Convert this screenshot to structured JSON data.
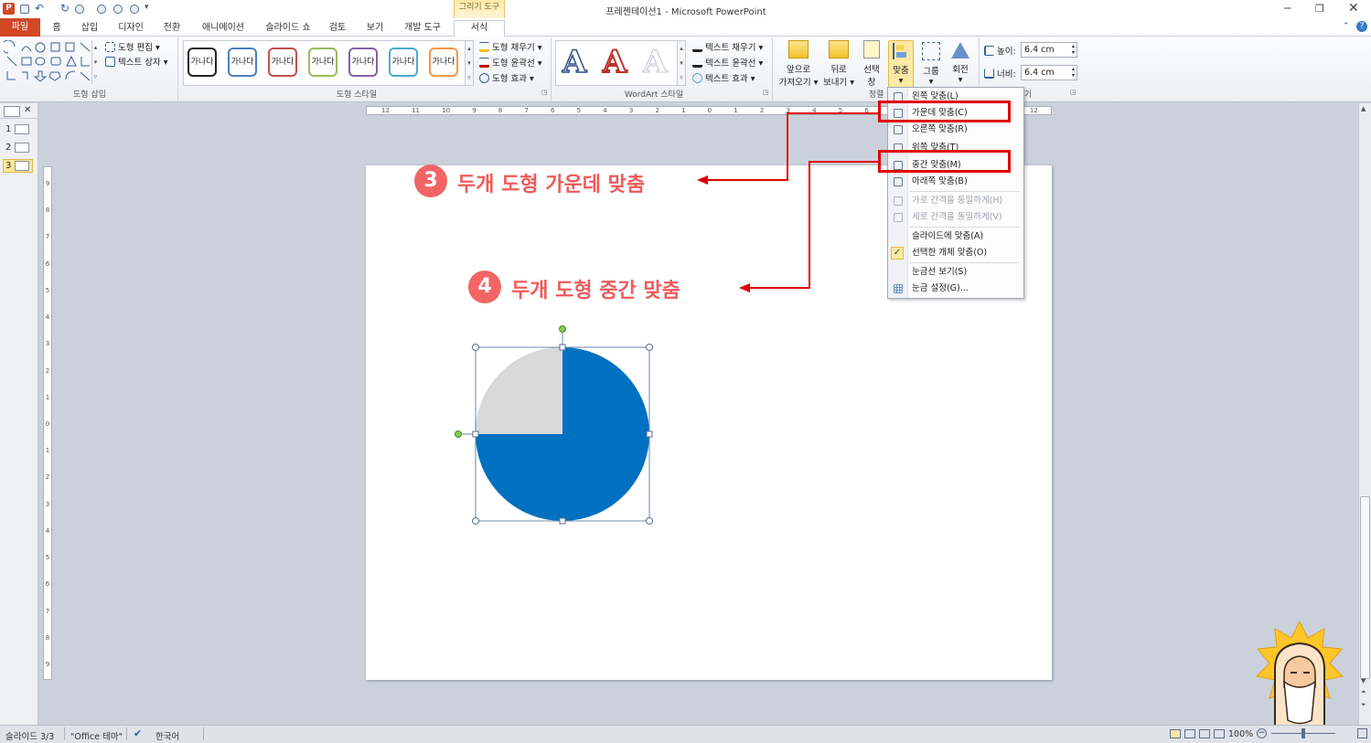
{
  "window": {
    "title": "프레젠테이션1 - Microsoft PowerPoint",
    "context_tab_group": "그리기 도구"
  },
  "tabs": [
    "파일",
    "홈",
    "삽입",
    "디자인",
    "전환",
    "애니메이션",
    "슬라이드 쇼",
    "검토",
    "보기",
    "개발 도구",
    "서식"
  ],
  "ribbon": {
    "groups": {
      "insert_shapes": "도형 삽입",
      "shape_styles": "도형 스타일",
      "wordart_styles": "WordArt 스타일",
      "arrange": "정렬",
      "size": "기"
    },
    "edit_shape": "도형 편집",
    "text_box": "텍스트 상자",
    "style_sample": "가나다",
    "style_colors": [
      "#222222",
      "#4a7fc1",
      "#c0504d",
      "#9bbb59",
      "#8064a2",
      "#4bacc6",
      "#f79646"
    ],
    "shape_fill": "도형 채우기",
    "shape_outline": "도형 윤곽선",
    "shape_effects": "도형 효과",
    "text_fill": "텍스트 채우기",
    "text_outline": "텍스트 윤곽선",
    "text_effects": "텍스트 효과",
    "wordart_letter": "A",
    "bring_forward_1": "앞으로",
    "bring_forward_2": "가져오기",
    "send_backward_1": "뒤로",
    "send_backward_2": "보내기",
    "selection_pane_1": "선택",
    "selection_pane_2": "창",
    "align": "맞춤",
    "group": "그룹",
    "rotate": "회전",
    "height_label": "높이:",
    "height_value": "6.4 cm",
    "width_label": "너비:",
    "width_value": "6.4 cm"
  },
  "align_menu": {
    "items": [
      {
        "label": "왼쪽 맞춤(L)",
        "enabled": true
      },
      {
        "label": "가운데 맞춤(C)",
        "enabled": true
      },
      {
        "label": "오른쪽 맞춤(R)",
        "enabled": true
      },
      {
        "label": "위쪽 맞춤(T)",
        "enabled": true
      },
      {
        "label": "중간 맞춤(M)",
        "enabled": true
      },
      {
        "label": "아래쪽 맞춤(B)",
        "enabled": true
      },
      {
        "label": "가로 간격을 동일하게(H)",
        "enabled": false
      },
      {
        "label": "세로 간격을 동일하게(V)",
        "enabled": false
      },
      {
        "label": "슬라이드에 맞춤(A)",
        "enabled": true
      },
      {
        "label": "선택한 개체 맞춤(O)",
        "enabled": true,
        "checked": true
      },
      {
        "label": "눈금선 보기(S)",
        "enabled": true
      },
      {
        "label": "눈금 설정(G)...",
        "enabled": true
      }
    ]
  },
  "ruler": {
    "horizontal": [
      "12",
      "11",
      "10",
      "9",
      "8",
      "7",
      "6",
      "5",
      "4",
      "3",
      "2",
      "1",
      "0",
      "1",
      "2",
      "3",
      "4",
      "5",
      "6",
      "7",
      "8",
      "9",
      "10",
      "11",
      "12"
    ],
    "vertical": [
      "9",
      "8",
      "7",
      "6",
      "5",
      "4",
      "3",
      "2",
      "1",
      "0",
      "1",
      "2",
      "3",
      "4",
      "5",
      "6",
      "7",
      "8",
      "9"
    ]
  },
  "slides_pane": {
    "numbers": [
      "1",
      "2",
      "3"
    ],
    "selected": "3"
  },
  "annotations": {
    "step3_badge": "3",
    "step3_text": "두개 도형 가운데 맞춤",
    "step4_badge": "4",
    "step4_text": "두개 도형 중간 맞춤"
  },
  "shapes": {
    "circle_color": "#0070c0",
    "quarter_color": "#d9d9d9"
  },
  "status": {
    "slide": "슬라이드 3/3",
    "theme": "\"Office 테마\"",
    "language": "한국어",
    "zoom": "100%"
  }
}
